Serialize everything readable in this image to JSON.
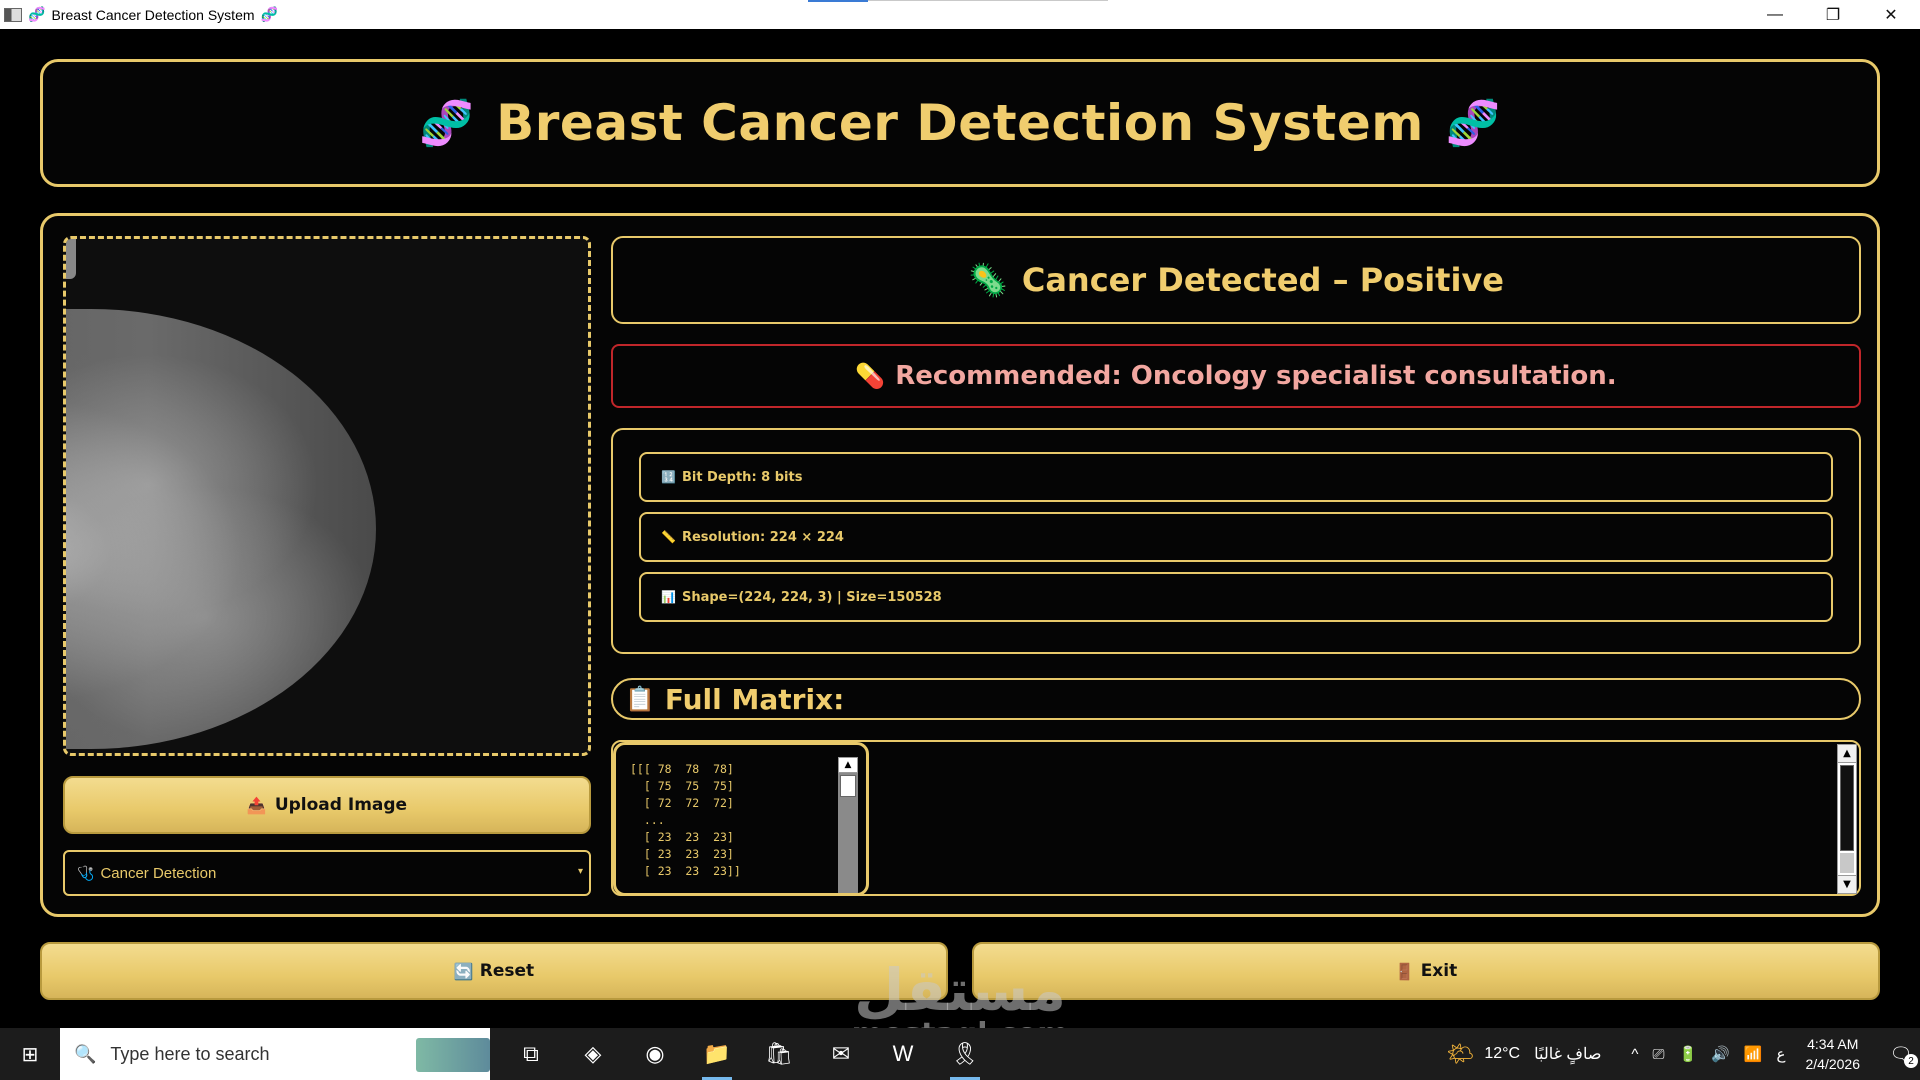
{
  "window": {
    "title": "Breast Cancer Detection System",
    "title_icon": "🧬",
    "minimize": "—",
    "maximize": "❐",
    "close": "✕"
  },
  "header": {
    "title": "Breast Cancer Detection System",
    "left_icon": "🧬",
    "right_icon": "🧬"
  },
  "image_panel": {
    "image_alt": "mammogram scan"
  },
  "upload_button": {
    "icon": "📤",
    "label": "Upload Image"
  },
  "mode_select": {
    "icon": "🩺",
    "selected": "Cancer Detection",
    "caret": "▾"
  },
  "result": {
    "icon": "🦠",
    "text": "Cancer Detected – Positive"
  },
  "recommendation": {
    "icon": "💊",
    "text": "Recommended: Oncology specialist consultation."
  },
  "image_info": {
    "bit_depth": {
      "icon": "🔢",
      "text": "Bit Depth: 8 bits"
    },
    "resolution": {
      "icon": "📏",
      "text": "Resolution: 224 × 224"
    },
    "shape": {
      "icon": "📊",
      "text": "Shape=(224, 224, 3) | Size=150528"
    }
  },
  "matrix": {
    "icon": "📋",
    "label": "Full Matrix:",
    "content": "[[[ 78  78  78]\n  [ 75  75  75]\n  [ 72  72  72]\n  ...\n  [ 23  23  23]\n  [ 23  23  23]\n  [ 23  23  23]]"
  },
  "buttons": {
    "reset": {
      "icon": "🔄",
      "label": "Reset"
    },
    "exit": {
      "icon": "🚪",
      "label": "Exit"
    }
  },
  "watermark": {
    "arabic": "مستقل",
    "latin": "mostaql.com"
  },
  "taskbar": {
    "start_icon": "⊞",
    "search_placeholder": "Type here to search",
    "search_icon": "🔍",
    "apps": [
      {
        "name": "task-view-icon",
        "glyph": "⧉"
      },
      {
        "name": "copilot-icon",
        "glyph": "◈"
      },
      {
        "name": "edge-icon",
        "glyph": "◉"
      },
      {
        "name": "file-explorer-icon",
        "glyph": "📁"
      },
      {
        "name": "store-icon",
        "glyph": "🛍"
      },
      {
        "name": "outlook-icon",
        "glyph": "✉"
      },
      {
        "name": "wps-icon",
        "glyph": "W"
      },
      {
        "name": "cancer-app-icon",
        "glyph": "🎗"
      }
    ],
    "weather": {
      "icon": "🌤",
      "temp": "12°C",
      "desc": "صافٍ غالبًا"
    },
    "tray_icons": [
      "^",
      "⎚",
      "🔋",
      "🔊",
      "📶",
      "ع"
    ],
    "time": "4:34 AM",
    "date": "2/4/2026",
    "notifications": "2"
  },
  "colors": {
    "accent_gold": "#e8c96a",
    "alert_red": "#c0262a",
    "background": "#000000"
  }
}
